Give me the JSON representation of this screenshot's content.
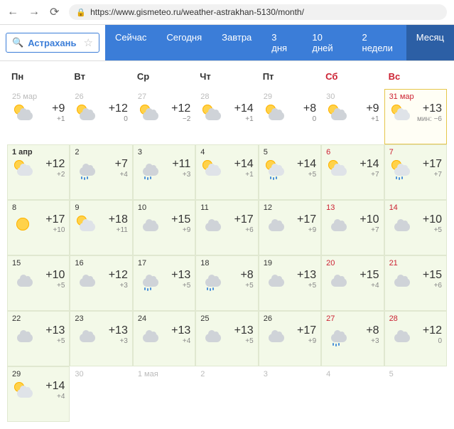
{
  "url": "https://www.gismeteo.ru/weather-astrakhan-5130/month/",
  "search_city": "Астрахань",
  "tabs": [
    "Сейчас",
    "Сегодня",
    "Завтра",
    "3 дня",
    "10 дней",
    "2 недели",
    "Месяц"
  ],
  "active_tab": 6,
  "weekdays": [
    {
      "label": "Пн",
      "weekend": false
    },
    {
      "label": "Вт",
      "weekend": false
    },
    {
      "label": "Ср",
      "weekend": false
    },
    {
      "label": "Чт",
      "weekend": false
    },
    {
      "label": "Пт",
      "weekend": false
    },
    {
      "label": "Сб",
      "weekend": true
    },
    {
      "label": "Вс",
      "weekend": true
    }
  ],
  "min_label": "мин:",
  "chart_data": {
    "type": "table",
    "title": "Прогноз погоды на месяц — Астрахань",
    "columns": [
      "date",
      "icon",
      "high",
      "low",
      "weekend",
      "style"
    ],
    "cells": [
      {
        "date": "25 мар",
        "icon": "partly",
        "hi": "+9",
        "lo": "+1",
        "weekend": false,
        "style": "past"
      },
      {
        "date": "26",
        "icon": "partly",
        "hi": "+12",
        "lo": "0",
        "weekend": false,
        "style": "past"
      },
      {
        "date": "27",
        "icon": "partly",
        "hi": "+12",
        "lo": "−2",
        "weekend": false,
        "style": "past"
      },
      {
        "date": "28",
        "icon": "partly",
        "hi": "+14",
        "lo": "+1",
        "weekend": false,
        "style": "past"
      },
      {
        "date": "29",
        "icon": "partly",
        "hi": "+8",
        "lo": "0",
        "weekend": false,
        "style": "past"
      },
      {
        "date": "30",
        "icon": "partly",
        "hi": "+9",
        "lo": "+1",
        "weekend": true,
        "style": "past"
      },
      {
        "date": "31 мар",
        "icon": "sun_cloud",
        "hi": "+13",
        "lo": "−6",
        "weekend": true,
        "style": "current",
        "min": true
      },
      {
        "date": "1 апр",
        "icon": "sun_cloud",
        "hi": "+12",
        "lo": "+2",
        "weekend": false,
        "style": "forecast",
        "bold": true
      },
      {
        "date": "2",
        "icon": "cloud_rain",
        "hi": "+7",
        "lo": "+4",
        "weekend": false,
        "style": "forecast"
      },
      {
        "date": "3",
        "icon": "cloud_rain",
        "hi": "+11",
        "lo": "+3",
        "weekend": false,
        "style": "forecast"
      },
      {
        "date": "4",
        "icon": "sun_cloud",
        "hi": "+14",
        "lo": "+1",
        "weekend": false,
        "style": "forecast"
      },
      {
        "date": "5",
        "icon": "sun_rain",
        "hi": "+14",
        "lo": "+5",
        "weekend": false,
        "style": "forecast"
      },
      {
        "date": "6",
        "icon": "sun_cloud",
        "hi": "+14",
        "lo": "+7",
        "weekend": true,
        "style": "forecast"
      },
      {
        "date": "7",
        "icon": "sun_rain",
        "hi": "+17",
        "lo": "+7",
        "weekend": true,
        "style": "forecast"
      },
      {
        "date": "8",
        "icon": "sun",
        "hi": "+17",
        "lo": "+10",
        "weekend": false,
        "style": "forecast"
      },
      {
        "date": "9",
        "icon": "sun_cloud",
        "hi": "+18",
        "lo": "+11",
        "weekend": false,
        "style": "forecast"
      },
      {
        "date": "10",
        "icon": "cloudy",
        "hi": "+15",
        "lo": "+9",
        "weekend": false,
        "style": "forecast"
      },
      {
        "date": "11",
        "icon": "cloudy",
        "hi": "+17",
        "lo": "+6",
        "weekend": false,
        "style": "forecast"
      },
      {
        "date": "12",
        "icon": "cloudy",
        "hi": "+17",
        "lo": "+9",
        "weekend": false,
        "style": "forecast"
      },
      {
        "date": "13",
        "icon": "cloudy",
        "hi": "+10",
        "lo": "+7",
        "weekend": true,
        "style": "forecast"
      },
      {
        "date": "14",
        "icon": "cloudy",
        "hi": "+10",
        "lo": "+5",
        "weekend": true,
        "style": "forecast"
      },
      {
        "date": "15",
        "icon": "cloudy",
        "hi": "+10",
        "lo": "+5",
        "weekend": false,
        "style": "forecast"
      },
      {
        "date": "16",
        "icon": "cloudy",
        "hi": "+12",
        "lo": "+3",
        "weekend": false,
        "style": "forecast"
      },
      {
        "date": "17",
        "icon": "cloud_rain",
        "hi": "+13",
        "lo": "+5",
        "weekend": false,
        "style": "forecast"
      },
      {
        "date": "18",
        "icon": "cloud_rain",
        "hi": "+8",
        "lo": "+5",
        "weekend": false,
        "style": "forecast"
      },
      {
        "date": "19",
        "icon": "cloudy",
        "hi": "+13",
        "lo": "+5",
        "weekend": false,
        "style": "forecast"
      },
      {
        "date": "20",
        "icon": "cloudy",
        "hi": "+15",
        "lo": "+4",
        "weekend": true,
        "style": "forecast"
      },
      {
        "date": "21",
        "icon": "cloudy",
        "hi": "+15",
        "lo": "+6",
        "weekend": true,
        "style": "forecast"
      },
      {
        "date": "22",
        "icon": "cloudy",
        "hi": "+13",
        "lo": "+5",
        "weekend": false,
        "style": "forecast"
      },
      {
        "date": "23",
        "icon": "cloudy",
        "hi": "+13",
        "lo": "+3",
        "weekend": false,
        "style": "forecast"
      },
      {
        "date": "24",
        "icon": "cloudy",
        "hi": "+13",
        "lo": "+4",
        "weekend": false,
        "style": "forecast"
      },
      {
        "date": "25",
        "icon": "cloudy",
        "hi": "+13",
        "lo": "+5",
        "weekend": false,
        "style": "forecast"
      },
      {
        "date": "26",
        "icon": "cloudy",
        "hi": "+17",
        "lo": "+9",
        "weekend": false,
        "style": "forecast"
      },
      {
        "date": "27",
        "icon": "cloud_rain",
        "hi": "+8",
        "lo": "+3",
        "weekend": true,
        "style": "forecast"
      },
      {
        "date": "28",
        "icon": "cloudy",
        "hi": "+12",
        "lo": "0",
        "weekend": true,
        "style": "forecast"
      },
      {
        "date": "29",
        "icon": "sun_cloud",
        "hi": "+14",
        "lo": "+4",
        "weekend": false,
        "style": "forecast"
      },
      {
        "date": "30",
        "icon": "",
        "hi": "",
        "lo": "",
        "weekend": false,
        "style": "future-dim"
      },
      {
        "date": "1 мая",
        "icon": "",
        "hi": "",
        "lo": "",
        "weekend": false,
        "style": "future-dim"
      },
      {
        "date": "2",
        "icon": "",
        "hi": "",
        "lo": "",
        "weekend": false,
        "style": "future-dim"
      },
      {
        "date": "3",
        "icon": "",
        "hi": "",
        "lo": "",
        "weekend": false,
        "style": "future-dim"
      },
      {
        "date": "4",
        "icon": "",
        "hi": "",
        "lo": "",
        "weekend": true,
        "style": "future-dim"
      },
      {
        "date": "5",
        "icon": "",
        "hi": "",
        "lo": "",
        "weekend": true,
        "style": "future-dim"
      }
    ]
  }
}
